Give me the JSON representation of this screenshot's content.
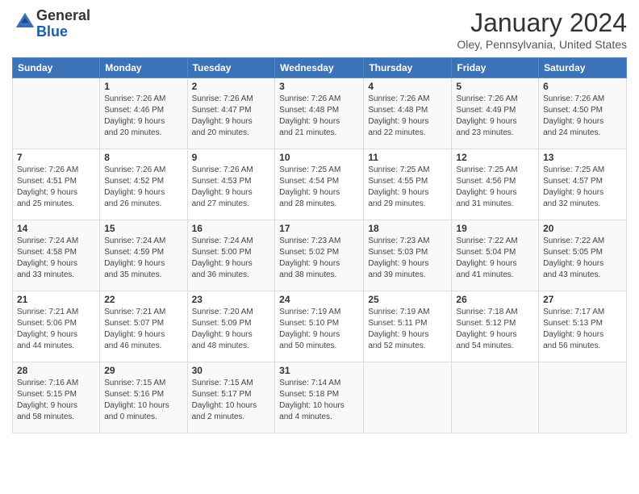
{
  "logo": {
    "general": "General",
    "blue": "Blue"
  },
  "header": {
    "month": "January 2024",
    "location": "Oley, Pennsylvania, United States"
  },
  "weekdays": [
    "Sunday",
    "Monday",
    "Tuesday",
    "Wednesday",
    "Thursday",
    "Friday",
    "Saturday"
  ],
  "weeks": [
    [
      {
        "day": "",
        "info": ""
      },
      {
        "day": "1",
        "info": "Sunrise: 7:26 AM\nSunset: 4:46 PM\nDaylight: 9 hours\nand 20 minutes."
      },
      {
        "day": "2",
        "info": "Sunrise: 7:26 AM\nSunset: 4:47 PM\nDaylight: 9 hours\nand 20 minutes."
      },
      {
        "day": "3",
        "info": "Sunrise: 7:26 AM\nSunset: 4:48 PM\nDaylight: 9 hours\nand 21 minutes."
      },
      {
        "day": "4",
        "info": "Sunrise: 7:26 AM\nSunset: 4:48 PM\nDaylight: 9 hours\nand 22 minutes."
      },
      {
        "day": "5",
        "info": "Sunrise: 7:26 AM\nSunset: 4:49 PM\nDaylight: 9 hours\nand 23 minutes."
      },
      {
        "day": "6",
        "info": "Sunrise: 7:26 AM\nSunset: 4:50 PM\nDaylight: 9 hours\nand 24 minutes."
      }
    ],
    [
      {
        "day": "7",
        "info": "Sunrise: 7:26 AM\nSunset: 4:51 PM\nDaylight: 9 hours\nand 25 minutes."
      },
      {
        "day": "8",
        "info": "Sunrise: 7:26 AM\nSunset: 4:52 PM\nDaylight: 9 hours\nand 26 minutes."
      },
      {
        "day": "9",
        "info": "Sunrise: 7:26 AM\nSunset: 4:53 PM\nDaylight: 9 hours\nand 27 minutes."
      },
      {
        "day": "10",
        "info": "Sunrise: 7:25 AM\nSunset: 4:54 PM\nDaylight: 9 hours\nand 28 minutes."
      },
      {
        "day": "11",
        "info": "Sunrise: 7:25 AM\nSunset: 4:55 PM\nDaylight: 9 hours\nand 29 minutes."
      },
      {
        "day": "12",
        "info": "Sunrise: 7:25 AM\nSunset: 4:56 PM\nDaylight: 9 hours\nand 31 minutes."
      },
      {
        "day": "13",
        "info": "Sunrise: 7:25 AM\nSunset: 4:57 PM\nDaylight: 9 hours\nand 32 minutes."
      }
    ],
    [
      {
        "day": "14",
        "info": "Sunrise: 7:24 AM\nSunset: 4:58 PM\nDaylight: 9 hours\nand 33 minutes."
      },
      {
        "day": "15",
        "info": "Sunrise: 7:24 AM\nSunset: 4:59 PM\nDaylight: 9 hours\nand 35 minutes."
      },
      {
        "day": "16",
        "info": "Sunrise: 7:24 AM\nSunset: 5:00 PM\nDaylight: 9 hours\nand 36 minutes."
      },
      {
        "day": "17",
        "info": "Sunrise: 7:23 AM\nSunset: 5:02 PM\nDaylight: 9 hours\nand 38 minutes."
      },
      {
        "day": "18",
        "info": "Sunrise: 7:23 AM\nSunset: 5:03 PM\nDaylight: 9 hours\nand 39 minutes."
      },
      {
        "day": "19",
        "info": "Sunrise: 7:22 AM\nSunset: 5:04 PM\nDaylight: 9 hours\nand 41 minutes."
      },
      {
        "day": "20",
        "info": "Sunrise: 7:22 AM\nSunset: 5:05 PM\nDaylight: 9 hours\nand 43 minutes."
      }
    ],
    [
      {
        "day": "21",
        "info": "Sunrise: 7:21 AM\nSunset: 5:06 PM\nDaylight: 9 hours\nand 44 minutes."
      },
      {
        "day": "22",
        "info": "Sunrise: 7:21 AM\nSunset: 5:07 PM\nDaylight: 9 hours\nand 46 minutes."
      },
      {
        "day": "23",
        "info": "Sunrise: 7:20 AM\nSunset: 5:09 PM\nDaylight: 9 hours\nand 48 minutes."
      },
      {
        "day": "24",
        "info": "Sunrise: 7:19 AM\nSunset: 5:10 PM\nDaylight: 9 hours\nand 50 minutes."
      },
      {
        "day": "25",
        "info": "Sunrise: 7:19 AM\nSunset: 5:11 PM\nDaylight: 9 hours\nand 52 minutes."
      },
      {
        "day": "26",
        "info": "Sunrise: 7:18 AM\nSunset: 5:12 PM\nDaylight: 9 hours\nand 54 minutes."
      },
      {
        "day": "27",
        "info": "Sunrise: 7:17 AM\nSunset: 5:13 PM\nDaylight: 9 hours\nand 56 minutes."
      }
    ],
    [
      {
        "day": "28",
        "info": "Sunrise: 7:16 AM\nSunset: 5:15 PM\nDaylight: 9 hours\nand 58 minutes."
      },
      {
        "day": "29",
        "info": "Sunrise: 7:15 AM\nSunset: 5:16 PM\nDaylight: 10 hours\nand 0 minutes."
      },
      {
        "day": "30",
        "info": "Sunrise: 7:15 AM\nSunset: 5:17 PM\nDaylight: 10 hours\nand 2 minutes."
      },
      {
        "day": "31",
        "info": "Sunrise: 7:14 AM\nSunset: 5:18 PM\nDaylight: 10 hours\nand 4 minutes."
      },
      {
        "day": "",
        "info": ""
      },
      {
        "day": "",
        "info": ""
      },
      {
        "day": "",
        "info": ""
      }
    ]
  ]
}
